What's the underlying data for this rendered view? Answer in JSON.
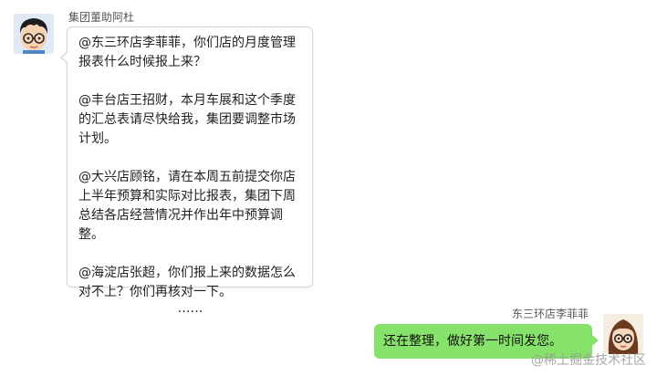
{
  "messages": {
    "incoming": {
      "sender": "集团董助阿杜",
      "paragraphs": [
        "@东三环店李菲菲，你们店的月度管理报表什么时候报上来？",
        "@丰台店王招财，本月车展和这个季度的汇总表请尽快给我，集团要调整市场计划。",
        "@大兴店顾铭，请在本周五前提交你店上半年预算和实际对比报表，集团下周总结各店经营情况并作出年中预算调整。",
        "@海淀店张超，你们报上来的数据怎么对不上？你们再核对一下。"
      ],
      "ellipsis": "……",
      "avatar_icon": "boy-with-glasses-avatar"
    },
    "outgoing": {
      "sender": "东三环店李菲菲",
      "text": "还在整理，做好第一时间发您。",
      "avatar_icon": "girl-with-glasses-avatar",
      "bubble_color": "#87e26b"
    }
  },
  "watermark": "@稀土掘金技术社区"
}
